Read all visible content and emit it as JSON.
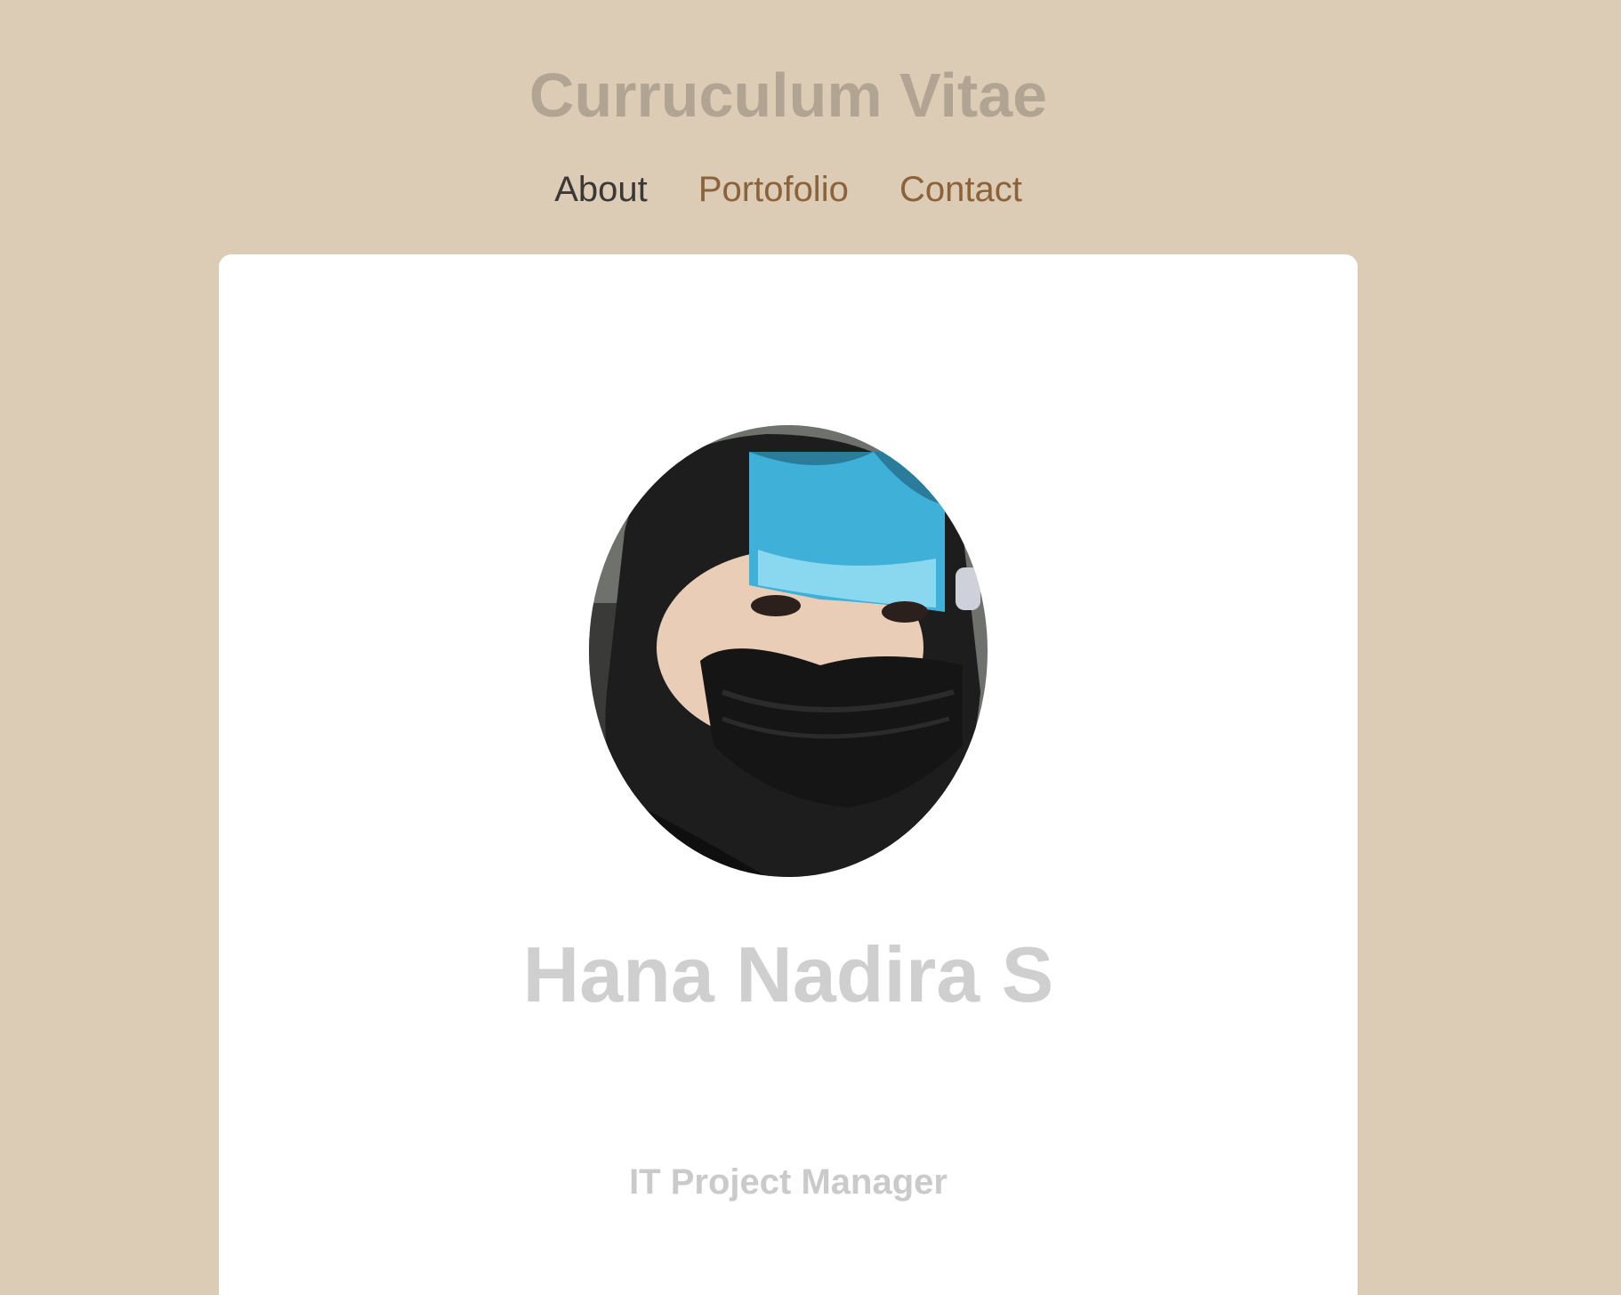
{
  "header": {
    "title": "Curruculum Vitae"
  },
  "nav": {
    "items": [
      {
        "label": "About",
        "active": true
      },
      {
        "label": "Portofolio",
        "active": false
      },
      {
        "label": "Contact",
        "active": false
      }
    ]
  },
  "profile": {
    "photo_icon": "profile-photo",
    "name": "Hana Nadira S",
    "role": "IT Project Manager"
  },
  "colors": {
    "background": "#dccbb5",
    "title": "#b1a493",
    "nav_active": "#3b3935",
    "nav_link": "#8b6239",
    "card": "#ffffff",
    "name": "#cfcfcf",
    "role": "#cacaca"
  }
}
